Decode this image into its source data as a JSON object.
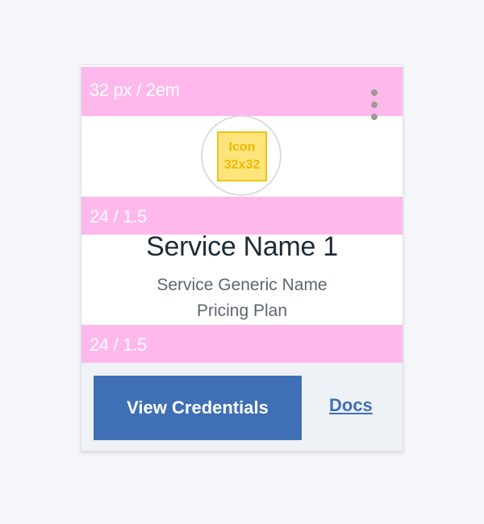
{
  "card": {
    "spacer_top_label": "32 px / 2em",
    "spacer_mid_label": "24 / 1.5",
    "spacer_bottom_label": "24 / 1.5",
    "icon": {
      "line1": "Icon",
      "line2": "32x32"
    },
    "service_name": "Service Name 1",
    "service_generic_name": "Service Generic Name",
    "pricing_plan": "Pricing Plan",
    "primary_button_label": "View Credentials",
    "docs_link_label": "Docs"
  },
  "colors": {
    "accent": "#3f6fb5",
    "spacer": "#ffb8ec",
    "icon_fill": "#fde57c",
    "icon_border": "#f3c017"
  },
  "icons": {
    "overflow": "overflow-menu-icon"
  }
}
